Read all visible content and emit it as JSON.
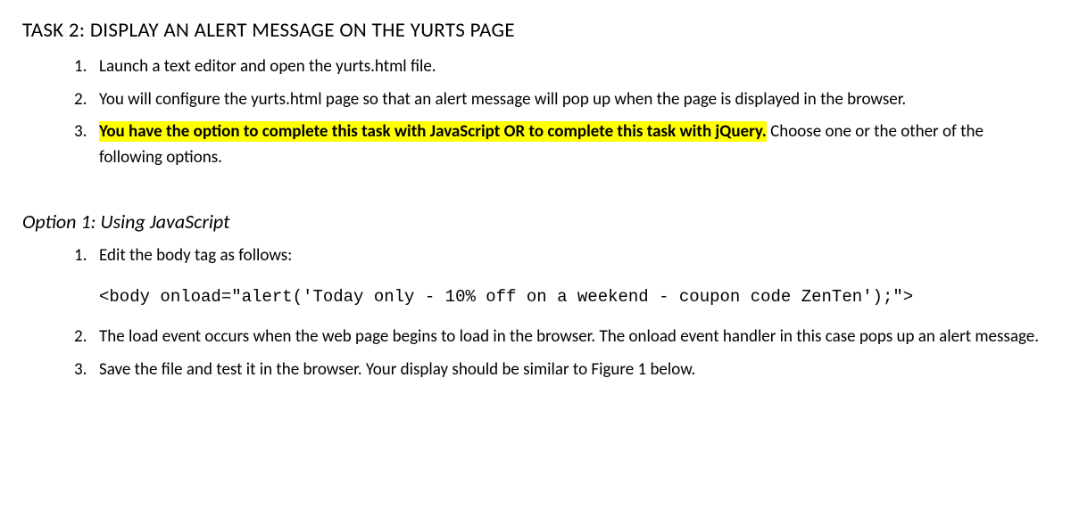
{
  "task": {
    "title": "TASK 2: DISPLAY AN ALERT MESSAGE ON THE YURTS PAGE",
    "steps": [
      {
        "num": "1.",
        "text": "Launch a text editor and open the yurts.html file."
      },
      {
        "num": "2.",
        "text": "You will configure the yurts.html page so that an alert message will pop up when the page is displayed in the browser."
      },
      {
        "num": "3.",
        "highlighted": "You have the option to complete this task with JavaScript OR to complete this task with jQuery.",
        "rest": " Choose one or the other of the following options."
      }
    ]
  },
  "option1": {
    "title": "Option 1: Using JavaScript",
    "steps": [
      {
        "num": "1.",
        "text": "Edit the body tag as follows:",
        "code": "<body onload=\"alert('Today only - 10% off on a weekend - coupon code ZenTen');\">"
      },
      {
        "num": "2.",
        "text": "The load event occurs when the web page begins to load in the browser. The onload event handler in this case pops up an alert message."
      },
      {
        "num": "3.",
        "text": "Save the file and test it in the browser. Your display should be similar to Figure 1 below."
      }
    ]
  }
}
